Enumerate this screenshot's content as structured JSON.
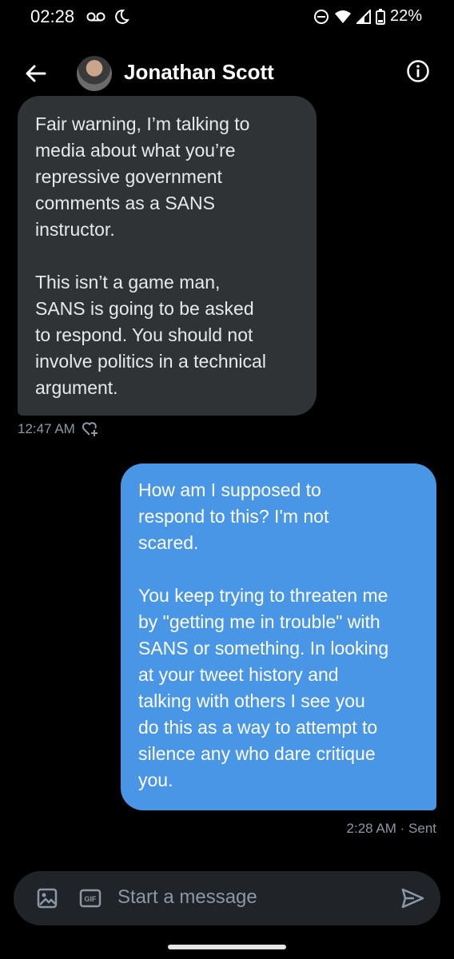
{
  "status_bar": {
    "time": "02:28",
    "battery": "22%"
  },
  "header": {
    "contact_name": "Jonathan Scott"
  },
  "messages": [
    {
      "direction": "received",
      "text": "Fair warning, I’m talking to\nmedia about what you’re\nrepressive government\ncomments as a SANS\ninstructor.\n\nThis isn’t a game man,\nSANS is going to be asked\nto respond. You should not\ninvolve politics in a technical\nargument.",
      "timestamp": "12:47 AM"
    },
    {
      "direction": "sent",
      "text": "How am I supposed to\nrespond to this? I'm not\nscared.\n\nYou keep trying to threaten me\nby \"getting me in trouble\" with\nSANS or something. In looking\nat your tweet history and\ntalking with others I see you\ndo this as a way to attempt to\nsilence any who dare critique\nyou.",
      "timestamp": "2:28 AM · Sent"
    }
  ],
  "composer": {
    "placeholder": "Start a message",
    "gif_label": "GIF"
  },
  "colors": {
    "background": "#000000",
    "received_bubble": "#2f3336",
    "sent_bubble": "#4a96e6",
    "muted_text": "#8b98a5"
  },
  "icons": [
    "voicemail-icon",
    "bedtime-icon",
    "dnd-icon",
    "wifi-icon",
    "signal-icon",
    "battery-icon",
    "back-arrow-icon",
    "info-icon",
    "heart-add-icon",
    "image-icon",
    "gif-icon",
    "send-icon"
  ]
}
